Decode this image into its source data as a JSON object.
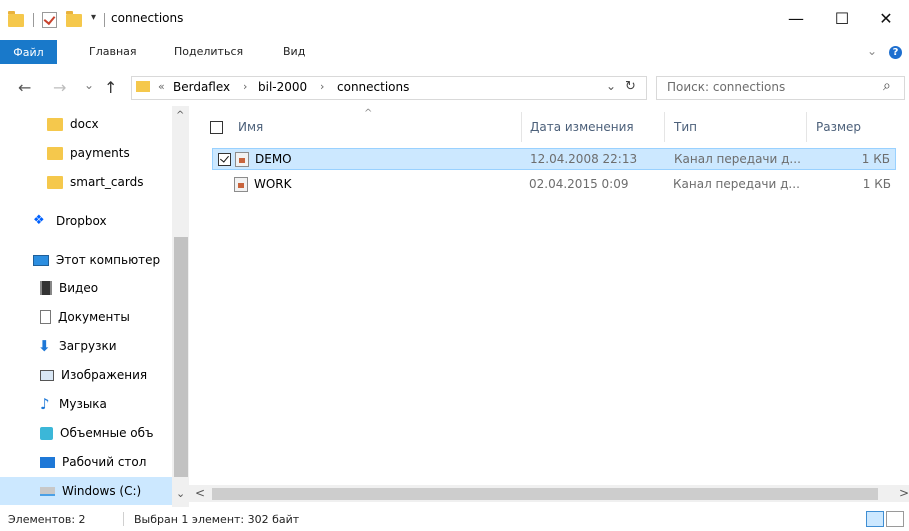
{
  "window": {
    "title": "connections",
    "qa_dropdown": "▾",
    "minimize": "—",
    "maximize": "☐",
    "close": "✕"
  },
  "ribbon": {
    "tabs": [
      "Файл",
      "Главная",
      "Поделиться",
      "Вид"
    ],
    "expand_icon": "chevron-down-icon",
    "help_label": "?"
  },
  "address": {
    "overflow": "«",
    "breadcrumb": [
      "Berdaflex",
      "bil-2000",
      "connections"
    ],
    "separator": "›",
    "dropdown": "⌄",
    "refresh": "↻"
  },
  "search": {
    "placeholder": "Поиск: connections",
    "icon": "⌕"
  },
  "sidebar": {
    "items": [
      {
        "label": "docx",
        "icon": "folder-icon"
      },
      {
        "label": "payments",
        "icon": "folder-icon"
      },
      {
        "label": "smart_cards",
        "icon": "folder-icon"
      },
      {
        "label": "Dropbox",
        "icon": "dropbox-icon"
      },
      {
        "label": "Этот компьютер",
        "icon": "computer-icon"
      },
      {
        "label": "Видео",
        "icon": "video-icon"
      },
      {
        "label": "Документы",
        "icon": "documents-icon"
      },
      {
        "label": "Загрузки",
        "icon": "downloads-icon"
      },
      {
        "label": "Изображения",
        "icon": "images-icon"
      },
      {
        "label": "Музыка",
        "icon": "music-icon"
      },
      {
        "label": "Объемные объ",
        "icon": "3d-objects-icon"
      },
      {
        "label": "Рабочий стол",
        "icon": "desktop-icon"
      },
      {
        "label": "Windows (C:)",
        "icon": "drive-icon",
        "selected": true
      }
    ]
  },
  "columns": {
    "name": "Имя",
    "modified": "Дата изменения",
    "type": "Тип",
    "size": "Размер",
    "sort_indicator": "^"
  },
  "files": [
    {
      "name": "DEMO",
      "modified": "12.04.2008 22:13",
      "type": "Канал передачи д...",
      "size": "1 КБ",
      "selected": true,
      "checked": true
    },
    {
      "name": "WORK",
      "modified": "02.04.2015 0:09",
      "type": "Канал передачи д...",
      "size": "1 КБ",
      "selected": false,
      "checked": false
    }
  ],
  "scroll": {
    "up": "^",
    "down": "⌄",
    "left": "<",
    "right": ">"
  },
  "status": {
    "items_count": "Элементов: 2",
    "selection": "Выбран 1 элемент: 302 байт"
  },
  "colors": {
    "accent": "#1979ca",
    "selection_bg": "#cce8ff",
    "selection_border": "#99d1ff",
    "folder": "#f5c84c"
  }
}
